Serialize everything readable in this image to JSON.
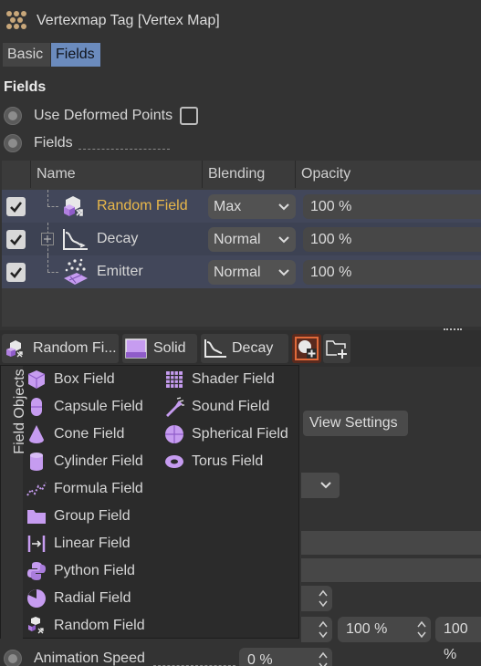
{
  "window": {
    "title": "Vertexmap Tag [Vertex Map]"
  },
  "tabs": [
    {
      "label": "Basic",
      "active": false
    },
    {
      "label": "Fields",
      "active": true
    }
  ],
  "section": {
    "title": "Fields"
  },
  "options": {
    "use_deformed_points": {
      "label": "Use Deformed Points",
      "checked": false
    },
    "fields": {
      "label": "Fields"
    }
  },
  "layer_table": {
    "columns": [
      "Name",
      "Blending",
      "Opacity"
    ],
    "rows": [
      {
        "name": "Random Field",
        "blending": "Max",
        "opacity": "100 %",
        "enabled": true,
        "selected": true,
        "icon": "random-field-icon"
      },
      {
        "name": "Decay",
        "blending": "Normal",
        "opacity": "100 %",
        "enabled": true,
        "selected": false,
        "icon": "decay-icon"
      },
      {
        "name": "Emitter",
        "blending": "Normal",
        "opacity": "100 %",
        "enabled": true,
        "selected": false,
        "icon": "emitter-icon"
      }
    ]
  },
  "toolbar": {
    "random_field": "Random Fi...",
    "solid": "Solid",
    "decay": "Decay"
  },
  "background": {
    "view_settings": "View Settings",
    "opacity_a": "100 %",
    "opacity_b": "100 %",
    "animation_speed_label": "Animation Speed",
    "animation_speed_value": "0 %"
  },
  "popup": {
    "side_label": "Field Objects",
    "left_items": [
      {
        "label": "Box Field",
        "icon": "box-field-icon"
      },
      {
        "label": "Capsule Field",
        "icon": "capsule-field-icon"
      },
      {
        "label": "Cone Field",
        "icon": "cone-field-icon"
      },
      {
        "label": "Cylinder Field",
        "icon": "cylinder-field-icon"
      },
      {
        "label": "Formula Field",
        "icon": "formula-field-icon"
      },
      {
        "label": "Group Field",
        "icon": "group-field-icon"
      },
      {
        "label": "Linear Field",
        "icon": "linear-field-icon"
      },
      {
        "label": "Python Field",
        "icon": "python-field-icon"
      },
      {
        "label": "Radial Field",
        "icon": "radial-field-icon"
      },
      {
        "label": "Random Field",
        "icon": "random-field-icon"
      }
    ],
    "right_items": [
      {
        "label": "Shader Field",
        "icon": "shader-field-icon"
      },
      {
        "label": "Sound Field",
        "icon": "sound-field-icon"
      },
      {
        "label": "Spherical Field",
        "icon": "spherical-field-icon"
      },
      {
        "label": "Torus Field",
        "icon": "torus-field-icon"
      }
    ]
  },
  "colors": {
    "accent": "#6b8bbd",
    "selected_name": "#e8b74a",
    "field_purple": "#c69cf0",
    "row_bg": "#42475a"
  }
}
